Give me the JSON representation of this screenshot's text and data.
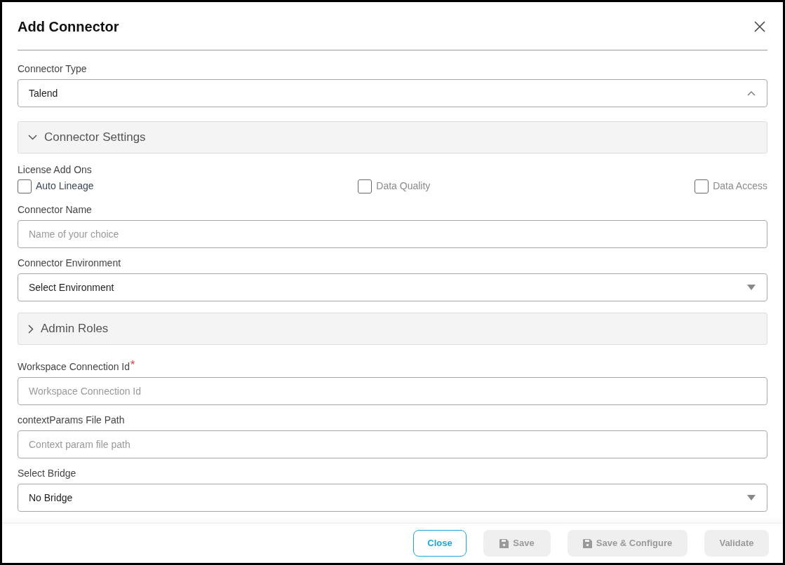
{
  "dialog": {
    "title": "Add Connector"
  },
  "fields": [
    {
      "kind": "select",
      "label": "Connector Type",
      "value": "Talend",
      "expanded": true
    },
    {
      "kind": "section",
      "title": "Connector Settings",
      "expanded": true
    },
    {
      "kind": "checkboxes",
      "label": "License Add Ons",
      "options": [
        {
          "label": "Auto Lineage",
          "checked": false,
          "disabled": false
        },
        {
          "label": "Data Quality",
          "checked": false,
          "disabled": true
        },
        {
          "label": "Data Access",
          "checked": false,
          "disabled": true
        }
      ]
    },
    {
      "kind": "input",
      "label": "Connector Name",
      "placeholder": "Name of your choice"
    },
    {
      "kind": "select",
      "label": "Connector Environment",
      "value": "Select Environment",
      "expanded": false
    },
    {
      "kind": "section",
      "title": "Admin Roles",
      "expanded": false
    },
    {
      "kind": "input",
      "label": "Workspace Connection Id",
      "placeholder": "Workspace Connection Id",
      "required_mark": "*"
    },
    {
      "kind": "input",
      "label": "contextParams File Path",
      "placeholder": "Context param file path"
    },
    {
      "kind": "select",
      "label": "Select Bridge",
      "value": "No Bridge",
      "expanded": false
    }
  ],
  "buttons": [
    {
      "kind": "outline",
      "label": "Close",
      "disabled": false
    },
    {
      "kind": "save",
      "label": "Save",
      "disabled": true
    },
    {
      "kind": "save",
      "label": "Save & Configure",
      "disabled": true
    },
    {
      "kind": "plain",
      "label": "Validate",
      "disabled": true
    }
  ]
}
